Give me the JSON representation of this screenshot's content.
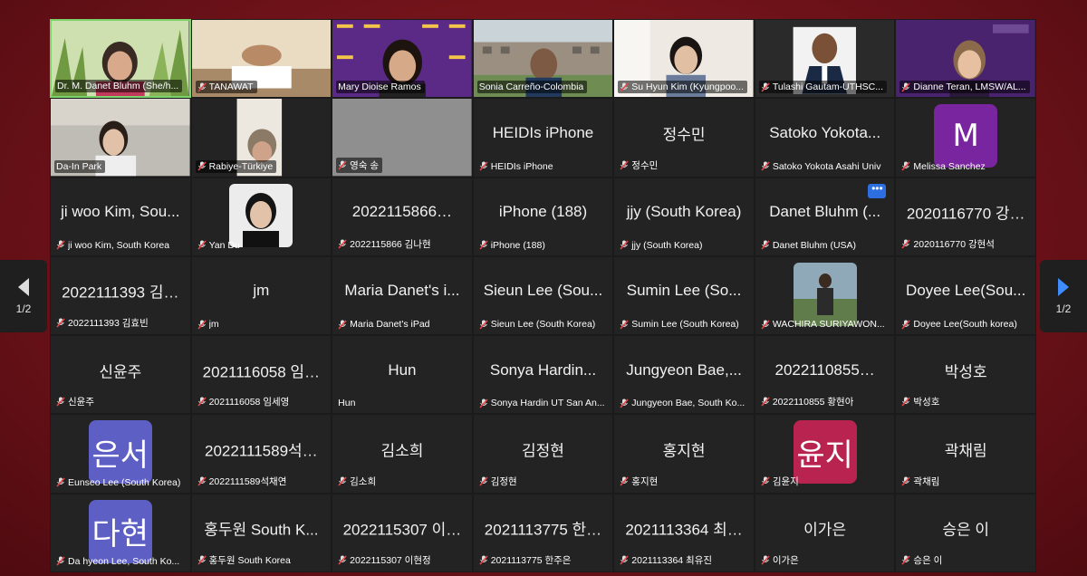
{
  "pager": {
    "left_page": "1/2",
    "right_page": "1/2"
  },
  "tiles": [
    {
      "label": "Dr. M. Danet Bluhm (She/h...",
      "video": "plant",
      "active": true,
      "muted": false
    },
    {
      "label": "TANAWAT",
      "video": "room",
      "muted": true
    },
    {
      "label": "Mary Dioise Ramos",
      "video": "purple-banner",
      "muted": false
    },
    {
      "label": "Sonia Carreño-Colombia",
      "video": "campus",
      "muted": false
    },
    {
      "label": "Su Hyun Kim (Kyungpoo...",
      "video": "office-light",
      "muted": true
    },
    {
      "label": "Tulashi Gautam-UTHSC...",
      "video": "portrait-suit",
      "muted": true
    },
    {
      "label": "Dianne Teran, LMSW/AL...",
      "video": "purple-alz",
      "muted": true
    },
    {
      "label": "Da-In Park",
      "video": "home",
      "muted": false
    },
    {
      "label": "Rabiye-Türkiye",
      "video": "beige-head",
      "muted": true
    },
    {
      "label": "영숙 송",
      "video": "gray",
      "muted": true
    },
    {
      "label": "HEIDIs iPhone",
      "name": "HEIDIs iPhone",
      "muted": true
    },
    {
      "label": "정수민",
      "name": "정수민",
      "muted": true
    },
    {
      "label": "Satoko Yokota Asahi Univ",
      "name": "Satoko Yokota...",
      "muted": true
    },
    {
      "label": "Melissa Sanchez",
      "avatar": "M",
      "avatar_color": "#7a25a0",
      "muted": true
    },
    {
      "label": "ji woo Kim, South Korea",
      "name": "ji woo Kim, Sou...",
      "muted": true
    },
    {
      "label": "Yan Du",
      "photo": "yan",
      "muted": true
    },
    {
      "label": "2022115866 김나현",
      "name": "2022115866…",
      "muted": true
    },
    {
      "label": "iPhone (188)",
      "name": "iPhone (188)",
      "muted": true
    },
    {
      "label": "jjy (South Korea)",
      "name": "jjy (South Korea)",
      "muted": true
    },
    {
      "label": "Danet Bluhm (USA)",
      "name": "Danet Bluhm (...",
      "muted": true,
      "more": "•••"
    },
    {
      "label": "2020116770 강현석",
      "name": "2020116770 강…",
      "muted": true
    },
    {
      "label": "2022111393 김효빈",
      "name": "2022111393 김…",
      "muted": true
    },
    {
      "label": "jm",
      "name": "jm",
      "muted": true
    },
    {
      "label": "Maria Danet's iPad",
      "name": "Maria Danet's i...",
      "muted": true
    },
    {
      "label": "Sieun Lee (South Korea)",
      "name": "Sieun Lee (Sou...",
      "muted": true
    },
    {
      "label": "Sumin Lee (South Korea)",
      "name": "Sumin Lee (So...",
      "muted": true
    },
    {
      "label": "WACHIRA SURIYAWON...",
      "photo": "wachira",
      "muted": true
    },
    {
      "label": "Doyee Lee(South korea)",
      "name": "Doyee Lee(Sou...",
      "muted": true
    },
    {
      "label": "신윤주",
      "name": "신윤주",
      "muted": true
    },
    {
      "label": "2021116058 임세영",
      "name": "2021116058 임…",
      "muted": true
    },
    {
      "label": "Hun",
      "name": "Hun",
      "muted": false
    },
    {
      "label": "Sonya Hardin UT San An...",
      "name": "Sonya Hardin...",
      "muted": true
    },
    {
      "label": "Jungyeon Bae, South Ko...",
      "name": "Jungyeon Bae,...",
      "muted": true
    },
    {
      "label": "2022110855 황현아",
      "name": "2022110855…",
      "muted": true
    },
    {
      "label": "박성호",
      "name": "박성호",
      "muted": true
    },
    {
      "label": "Eunseo Lee (South Korea)",
      "avatar": "은서",
      "avatar_color": "#5d5fc5",
      "muted": true
    },
    {
      "label": "2022111589석채연",
      "name": "2022111589석…",
      "muted": true
    },
    {
      "label": "김소희",
      "name": "김소희",
      "muted": true
    },
    {
      "label": "김정현",
      "name": "김정현",
      "muted": true
    },
    {
      "label": "홍지현",
      "name": "홍지현",
      "muted": true
    },
    {
      "label": "김윤지",
      "avatar": "윤지",
      "avatar_color": "#b8234f",
      "muted": true
    },
    {
      "label": "곽채림",
      "name": "곽채림",
      "muted": true
    },
    {
      "label": "Da hyeon Lee, South Ko...",
      "avatar": "다현",
      "avatar_color": "#5d5fc5",
      "muted": true
    },
    {
      "label": "홍두원 South Korea",
      "name": "홍두원 South K...",
      "muted": true
    },
    {
      "label": "2022115307 이현정",
      "name": "2022115307 이…",
      "muted": true
    },
    {
      "label": "2021113775 한주은",
      "name": "2021113775 한…",
      "muted": true
    },
    {
      "label": "2021113364 최유진",
      "name": "2021113364 최…",
      "muted": true
    },
    {
      "label": "이가은",
      "name": "이가은",
      "muted": true
    },
    {
      "label": "승은 이",
      "name": "승은 이",
      "muted": true
    }
  ]
}
